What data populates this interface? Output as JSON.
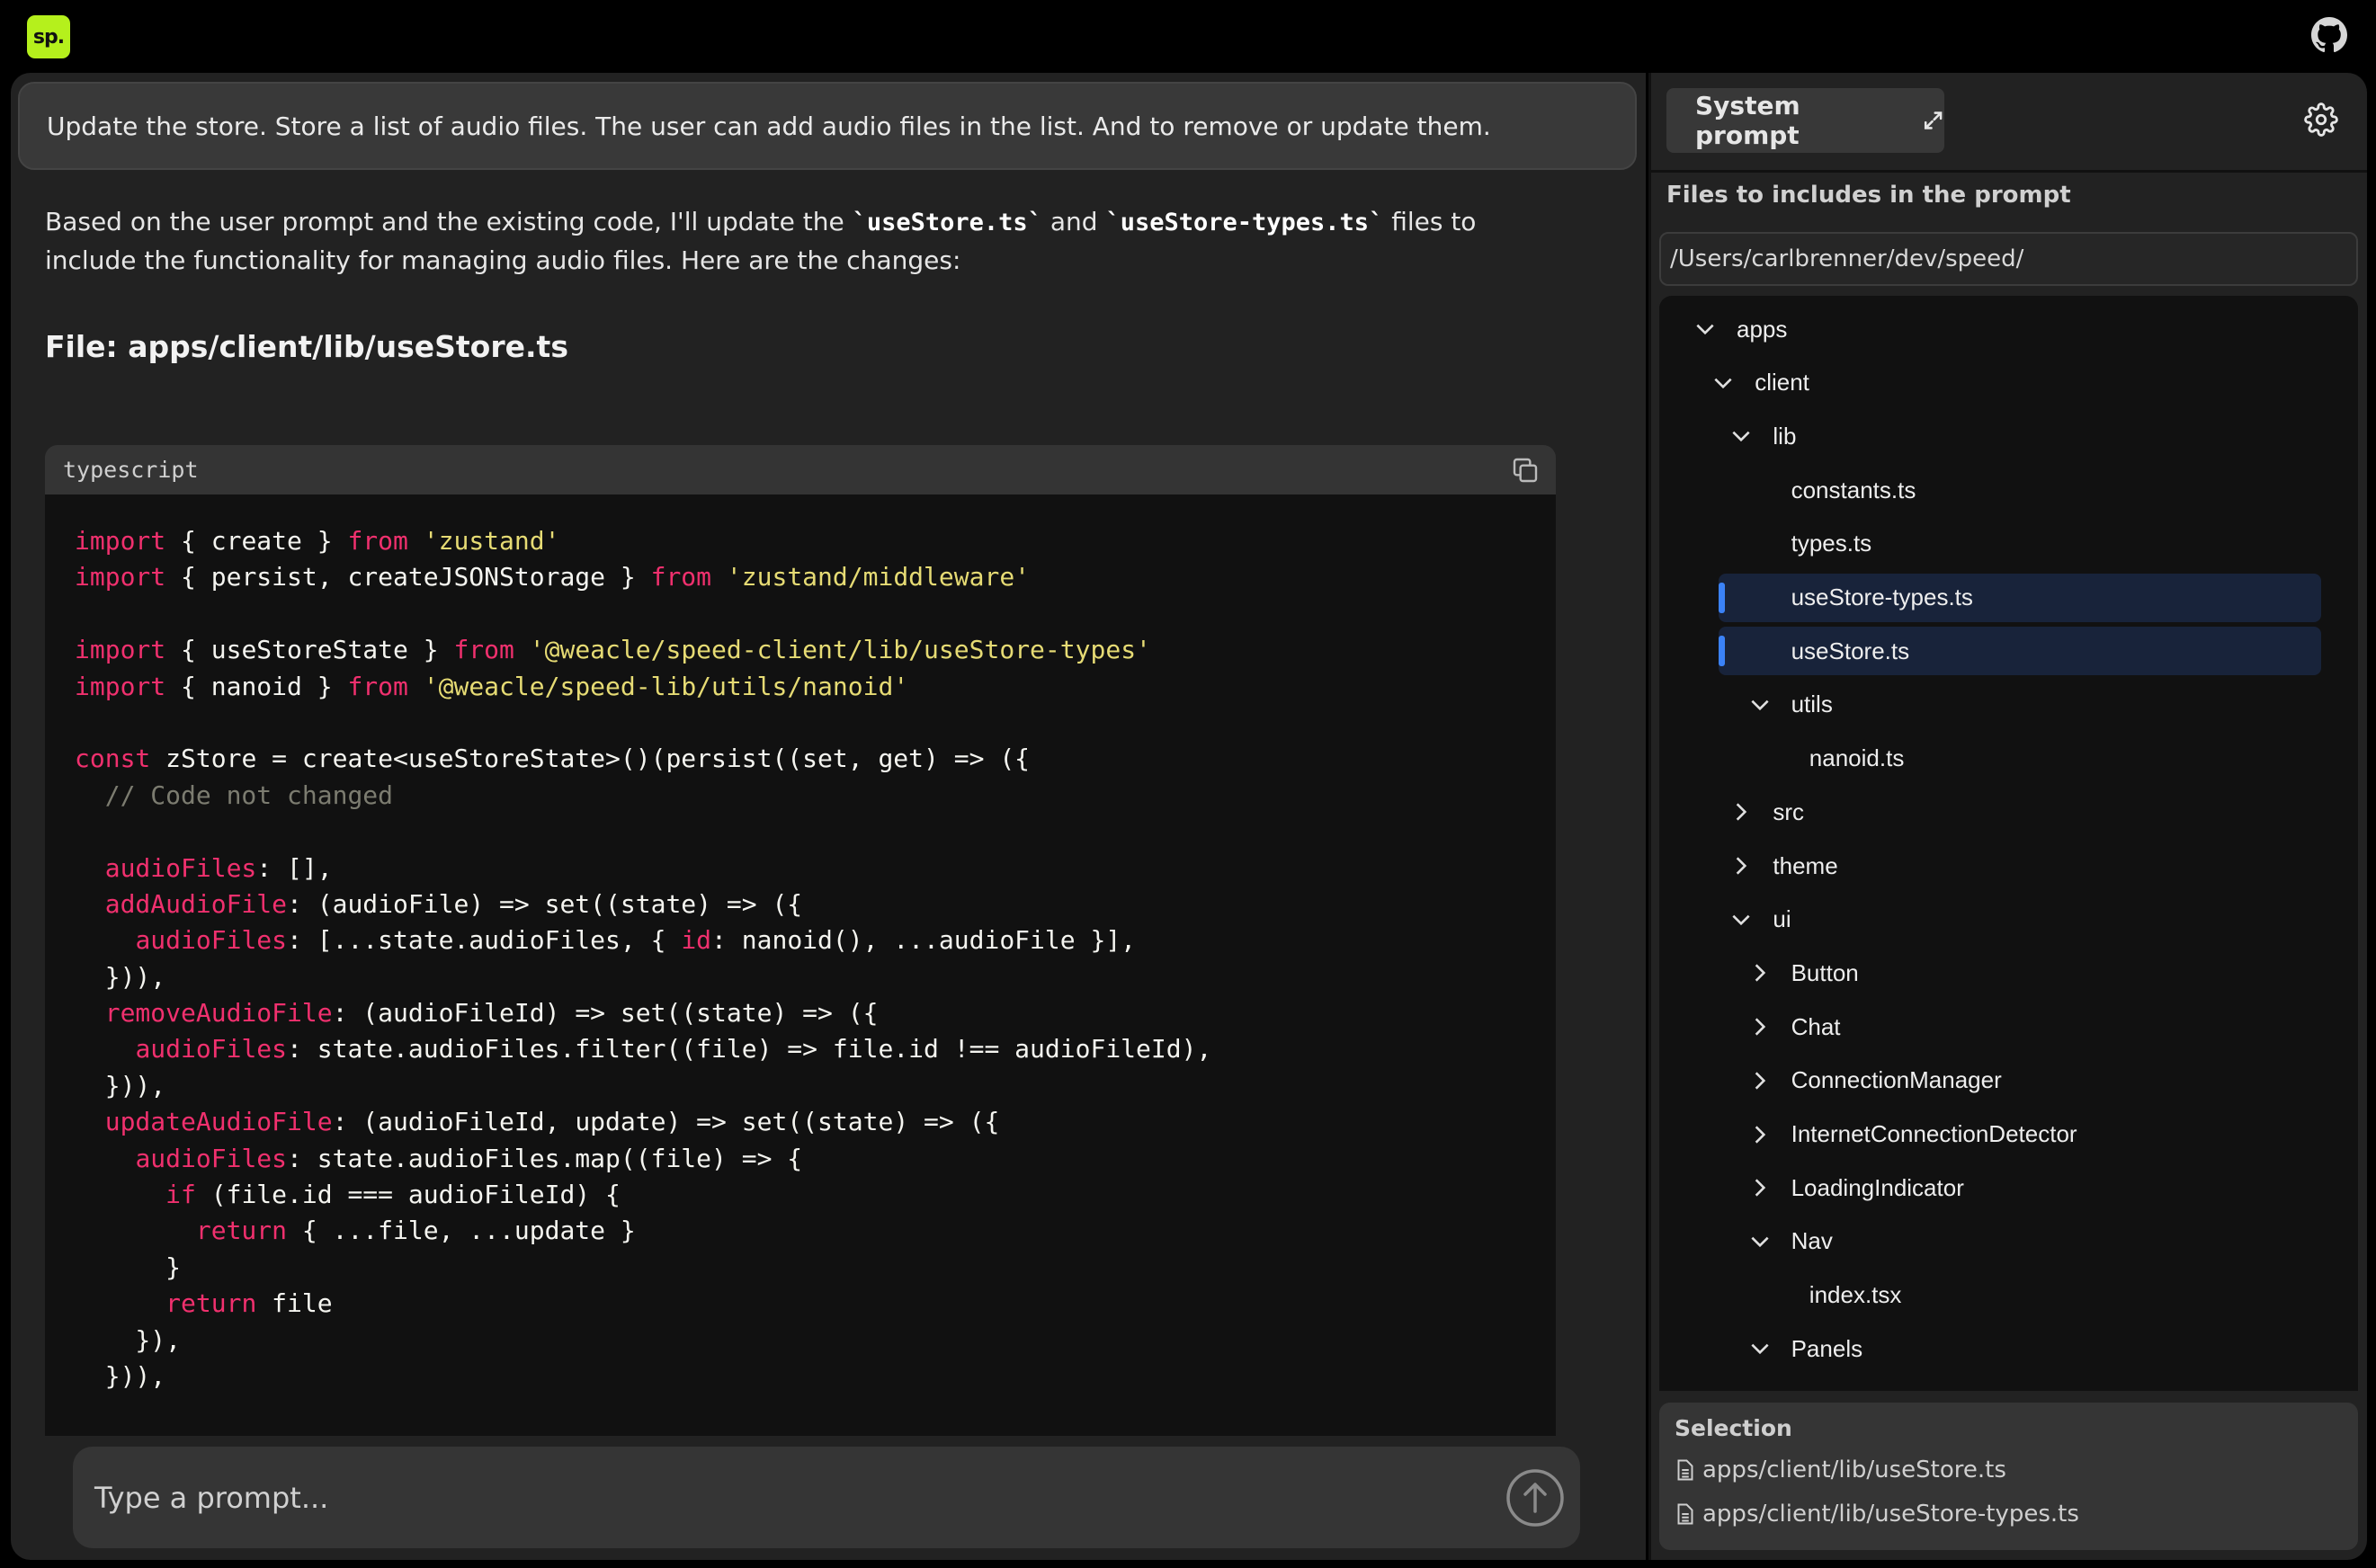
{
  "app": {
    "logo_text": "sp."
  },
  "chat": {
    "user_message": "Update the store. Store a list of audio files. The user can add audio files in the list. And to remove or update them.",
    "reply": {
      "part1": "Based on the user prompt and the existing code, I'll update the ",
      "code1": "`useStore.ts`",
      "part2": " and ",
      "code2": "`useStore-types.ts`",
      "part3": " files to include the functionality for managing audio files. Here are the changes:"
    },
    "file_heading": "File: apps/client/lib/useStore.ts",
    "code_block": {
      "language": "typescript",
      "lines": [
        [
          [
            "k",
            "import"
          ],
          [
            "p",
            " { create } "
          ],
          [
            "k",
            "from"
          ],
          [
            "p",
            " "
          ],
          [
            "s",
            "'zustand'"
          ]
        ],
        [
          [
            "k",
            "import"
          ],
          [
            "p",
            " { persist, createJSONStorage } "
          ],
          [
            "k",
            "from"
          ],
          [
            "p",
            " "
          ],
          [
            "s",
            "'zustand/middleware'"
          ]
        ],
        [],
        [
          [
            "k",
            "import"
          ],
          [
            "p",
            " { useStoreState } "
          ],
          [
            "k",
            "from"
          ],
          [
            "p",
            " "
          ],
          [
            "s",
            "'@weacle/speed-client/lib/useStore-types'"
          ]
        ],
        [
          [
            "k",
            "import"
          ],
          [
            "p",
            " { nanoid } "
          ],
          [
            "k",
            "from"
          ],
          [
            "p",
            " "
          ],
          [
            "s",
            "'@weacle/speed-lib/utils/nanoid'"
          ]
        ],
        [],
        [
          [
            "k",
            "const"
          ],
          [
            "p",
            " zStore = create<useStoreState>()(persist((set, get) => ({"
          ]
        ],
        [
          [
            "p",
            "  "
          ],
          [
            "c",
            "// Code not changed"
          ]
        ],
        [],
        [
          [
            "p",
            "  "
          ],
          [
            "k",
            "audioFiles"
          ],
          [
            "p",
            ": [],"
          ]
        ],
        [
          [
            "p",
            "  "
          ],
          [
            "k",
            "addAudioFile"
          ],
          [
            "p",
            ": (audioFile) => set((state) => ({"
          ]
        ],
        [
          [
            "p",
            "    "
          ],
          [
            "k",
            "audioFiles"
          ],
          [
            "p",
            ": [...state.audioFiles, { "
          ],
          [
            "k",
            "id"
          ],
          [
            "p",
            ": nanoid(), ...audioFile }],"
          ]
        ],
        [
          [
            "p",
            "  })),"
          ]
        ],
        [
          [
            "p",
            "  "
          ],
          [
            "k",
            "removeAudioFile"
          ],
          [
            "p",
            ": (audioFileId) => set((state) => ({"
          ]
        ],
        [
          [
            "p",
            "    "
          ],
          [
            "k",
            "audioFiles"
          ],
          [
            "p",
            ": state.audioFiles.filter((file) => file.id !== audioFileId),"
          ]
        ],
        [
          [
            "p",
            "  })),"
          ]
        ],
        [
          [
            "p",
            "  "
          ],
          [
            "k",
            "updateAudioFile"
          ],
          [
            "p",
            ": (audioFileId, update) => set((state) => ({"
          ]
        ],
        [
          [
            "p",
            "    "
          ],
          [
            "k",
            "audioFiles"
          ],
          [
            "p",
            ": state.audioFiles.map((file) => {"
          ]
        ],
        [
          [
            "p",
            "      "
          ],
          [
            "k",
            "if"
          ],
          [
            "p",
            " (file.id === audioFileId) {"
          ]
        ],
        [
          [
            "p",
            "        "
          ],
          [
            "k",
            "return"
          ],
          [
            "p",
            " { ...file, ...update }"
          ]
        ],
        [
          [
            "p",
            "      }"
          ]
        ],
        [
          [
            "p",
            "      "
          ],
          [
            "k",
            "return"
          ],
          [
            "p",
            " file"
          ]
        ],
        [
          [
            "p",
            "    }),"
          ]
        ],
        [
          [
            "p",
            "  })),"
          ]
        ]
      ]
    },
    "prompt_placeholder": "Type a prompt..."
  },
  "sidebar": {
    "system_prompt_label": "System prompt",
    "files_title": "Files to includes in the prompt",
    "path_value": "/Users/carlbrenner/dev/speed/",
    "tree": [
      {
        "name": "apps",
        "level": 0,
        "type": "folder",
        "open": true
      },
      {
        "name": "client",
        "level": 1,
        "type": "folder",
        "open": true
      },
      {
        "name": "lib",
        "level": 2,
        "type": "folder",
        "open": true
      },
      {
        "name": "constants.ts",
        "level": 3,
        "type": "file"
      },
      {
        "name": "types.ts",
        "level": 3,
        "type": "file"
      },
      {
        "name": "useStore-types.ts",
        "level": 3,
        "type": "file",
        "selected": true
      },
      {
        "name": "useStore.ts",
        "level": 3,
        "type": "file",
        "selected": true
      },
      {
        "name": "utils",
        "level": 3,
        "type": "folder",
        "open": true
      },
      {
        "name": "nanoid.ts",
        "level": 4,
        "type": "file"
      },
      {
        "name": "src",
        "level": 2,
        "type": "folder",
        "open": false
      },
      {
        "name": "theme",
        "level": 2,
        "type": "folder",
        "open": false
      },
      {
        "name": "ui",
        "level": 2,
        "type": "folder",
        "open": true
      },
      {
        "name": "Button",
        "level": 3,
        "type": "folder",
        "open": false
      },
      {
        "name": "Chat",
        "level": 3,
        "type": "folder",
        "open": false
      },
      {
        "name": "ConnectionManager",
        "level": 3,
        "type": "folder",
        "open": false
      },
      {
        "name": "InternetConnectionDetector",
        "level": 3,
        "type": "folder",
        "open": false
      },
      {
        "name": "LoadingIndicator",
        "level": 3,
        "type": "folder",
        "open": false
      },
      {
        "name": "Nav",
        "level": 3,
        "type": "folder",
        "open": true
      },
      {
        "name": "index.tsx",
        "level": 4,
        "type": "file"
      },
      {
        "name": "Panels",
        "level": 3,
        "type": "folder",
        "open": true
      }
    ],
    "selection": {
      "title": "Selection",
      "items": [
        "apps/client/lib/useStore.ts",
        "apps/client/lib/useStore-types.ts"
      ]
    }
  },
  "colors": {
    "logo": "#b5f01c",
    "selected_accent": "#3b82f6",
    "keyword": "#f0306e",
    "string": "#e6db74",
    "comment": "#7c7c70"
  }
}
